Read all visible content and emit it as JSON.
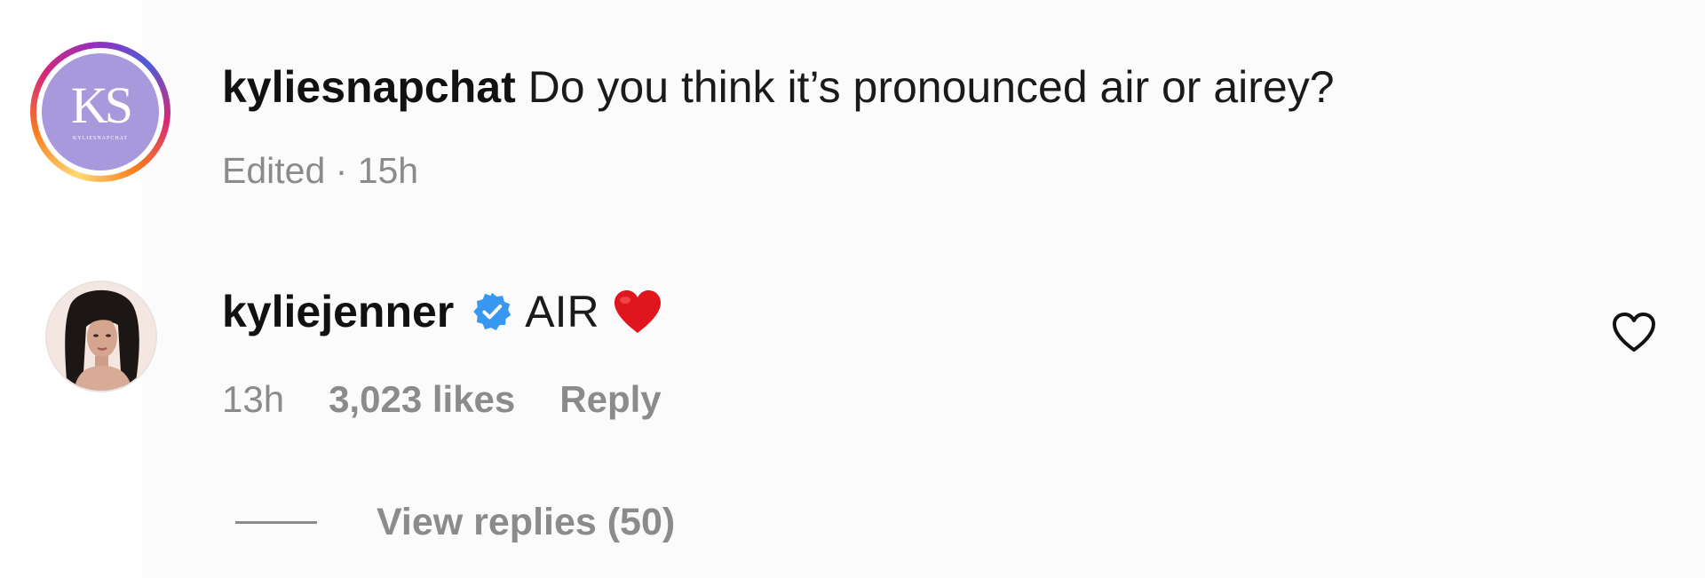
{
  "comments": [
    {
      "avatar": {
        "monogram": "KS",
        "sublabel": "KYLIESNAPCHAT",
        "ring": "story-gradient",
        "bg_color": "#a898dc"
      },
      "username": "kyliesnapchat",
      "text": "Do you think it’s pronounced air or airey?",
      "meta": "Edited · 15h"
    },
    {
      "avatar": {
        "description": "profile-photo"
      },
      "username": "kyliejenner",
      "verified_icon": "verified-badge-icon",
      "verified_color": "#3897f0",
      "text": "AIR",
      "emoji": "red-heart-emoji",
      "time": "13h",
      "likes": "3,023 likes",
      "reply_label": "Reply",
      "like_icon": "heart-outline-icon"
    }
  ],
  "view_replies_label": "View replies (50)"
}
